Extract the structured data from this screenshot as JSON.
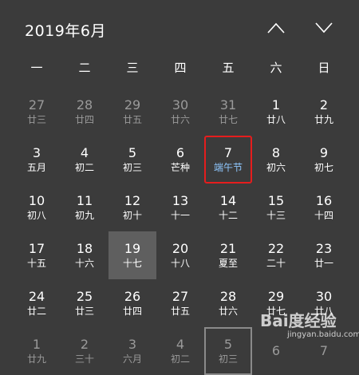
{
  "header": {
    "title": "2019年6月",
    "prev_icon": "chevron-up-icon",
    "next_icon": "chevron-down-icon"
  },
  "weekdays": [
    "一",
    "二",
    "三",
    "四",
    "五",
    "六",
    "日"
  ],
  "days": [
    {
      "num": "27",
      "lunar": "廿三",
      "other": true
    },
    {
      "num": "28",
      "lunar": "廿四",
      "other": true
    },
    {
      "num": "29",
      "lunar": "廿五",
      "other": true
    },
    {
      "num": "30",
      "lunar": "廿六",
      "other": true
    },
    {
      "num": "31",
      "lunar": "廿七",
      "other": true
    },
    {
      "num": "1",
      "lunar": "廿八"
    },
    {
      "num": "2",
      "lunar": "廿九"
    },
    {
      "num": "3",
      "lunar": "五月"
    },
    {
      "num": "4",
      "lunar": "初二"
    },
    {
      "num": "5",
      "lunar": "初三"
    },
    {
      "num": "6",
      "lunar": "芒种"
    },
    {
      "num": "7",
      "lunar": "端午节",
      "holiday": true,
      "annotated": true
    },
    {
      "num": "8",
      "lunar": "初六"
    },
    {
      "num": "9",
      "lunar": "初七"
    },
    {
      "num": "10",
      "lunar": "初八"
    },
    {
      "num": "11",
      "lunar": "初九"
    },
    {
      "num": "12",
      "lunar": "初十"
    },
    {
      "num": "13",
      "lunar": "十一"
    },
    {
      "num": "14",
      "lunar": "十二"
    },
    {
      "num": "15",
      "lunar": "十三"
    },
    {
      "num": "16",
      "lunar": "十四"
    },
    {
      "num": "17",
      "lunar": "十五"
    },
    {
      "num": "18",
      "lunar": "十六"
    },
    {
      "num": "19",
      "lunar": "十七",
      "highlight": true
    },
    {
      "num": "20",
      "lunar": "十八"
    },
    {
      "num": "21",
      "lunar": "夏至"
    },
    {
      "num": "22",
      "lunar": "二十"
    },
    {
      "num": "23",
      "lunar": "廿一"
    },
    {
      "num": "24",
      "lunar": "廿二"
    },
    {
      "num": "25",
      "lunar": "廿三"
    },
    {
      "num": "26",
      "lunar": "廿四"
    },
    {
      "num": "27",
      "lunar": "廿五"
    },
    {
      "num": "28",
      "lunar": "廿六"
    },
    {
      "num": "29",
      "lunar": "廿七"
    },
    {
      "num": "30",
      "lunar": "廿八"
    },
    {
      "num": "1",
      "lunar": "廿九",
      "other": true
    },
    {
      "num": "2",
      "lunar": "三十",
      "other": true
    },
    {
      "num": "3",
      "lunar": "六月",
      "other": true
    },
    {
      "num": "4",
      "lunar": "初二",
      "other": true
    },
    {
      "num": "5",
      "lunar": "初三",
      "other": true,
      "today": true
    },
    {
      "num": "6",
      "lunar": "",
      "other": true
    },
    {
      "num": "7",
      "lunar": "",
      "other": true
    }
  ],
  "watermark": {
    "logo": "Bai度经验",
    "url": "jingyan.baidu.com"
  },
  "colors": {
    "background": "#3b3b3b",
    "holiday_text": "#8fc8ff",
    "annotation_border": "#e51d1d",
    "highlight_bg": "#5f5f5f"
  }
}
